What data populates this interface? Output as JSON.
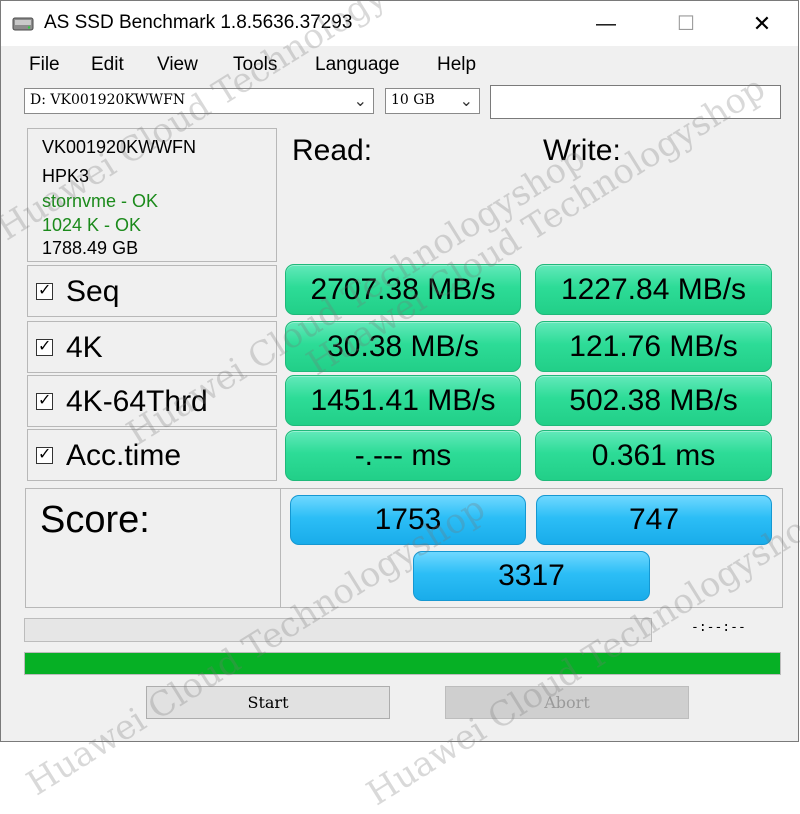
{
  "window": {
    "title": "AS SSD Benchmark 1.8.5636.37293",
    "minimize_glyph": "—",
    "maximize_glyph": "☐",
    "close_glyph": "✕",
    "icon": "disk-drive-icon"
  },
  "menu": [
    "File",
    "Edit",
    "View",
    "Tools",
    "Language",
    "Help"
  ],
  "drive_select": {
    "value": "D:  VK001920KWWFN",
    "icon": "chevron-down-icon"
  },
  "size_select": {
    "value": "10 GB",
    "icon": "chevron-down-icon"
  },
  "drive_info": {
    "model": "VK001920KWWFN",
    "firmware": "HPK3",
    "driver": "stornvme - OK",
    "alignment": "1024 K - OK",
    "capacity": "1788.49 GB"
  },
  "headers": {
    "read": "Read:",
    "write": "Write:"
  },
  "tests": [
    {
      "label": "Seq",
      "checked": true,
      "read": "2707.38 MB/s",
      "write": "1227.84 MB/s"
    },
    {
      "label": "4K",
      "checked": true,
      "read": "30.38 MB/s",
      "write": "121.76 MB/s"
    },
    {
      "label": "4K-64Thrd",
      "checked": true,
      "read": "1451.41 MB/s",
      "write": "502.38 MB/s"
    },
    {
      "label": "Acc.time",
      "checked": true,
      "read": "-.--- ms",
      "write": "0.361 ms"
    }
  ],
  "checkbox_glyph": "✓",
  "score": {
    "label": "Score:",
    "read": "1753",
    "write": "747",
    "total": "3317"
  },
  "progress": {
    "timer": "-:--:--",
    "overall_fraction": 1.0,
    "test_fraction": 0.0
  },
  "buttons": {
    "start": "Start",
    "abort": "Abort"
  },
  "watermark": "Huawei Cloud Technologyshop",
  "colors": {
    "result_green": "#2ddc97",
    "score_blue": "#2cbef6",
    "progress_green": "#06b025",
    "ok_green": "#1b8a1b"
  }
}
